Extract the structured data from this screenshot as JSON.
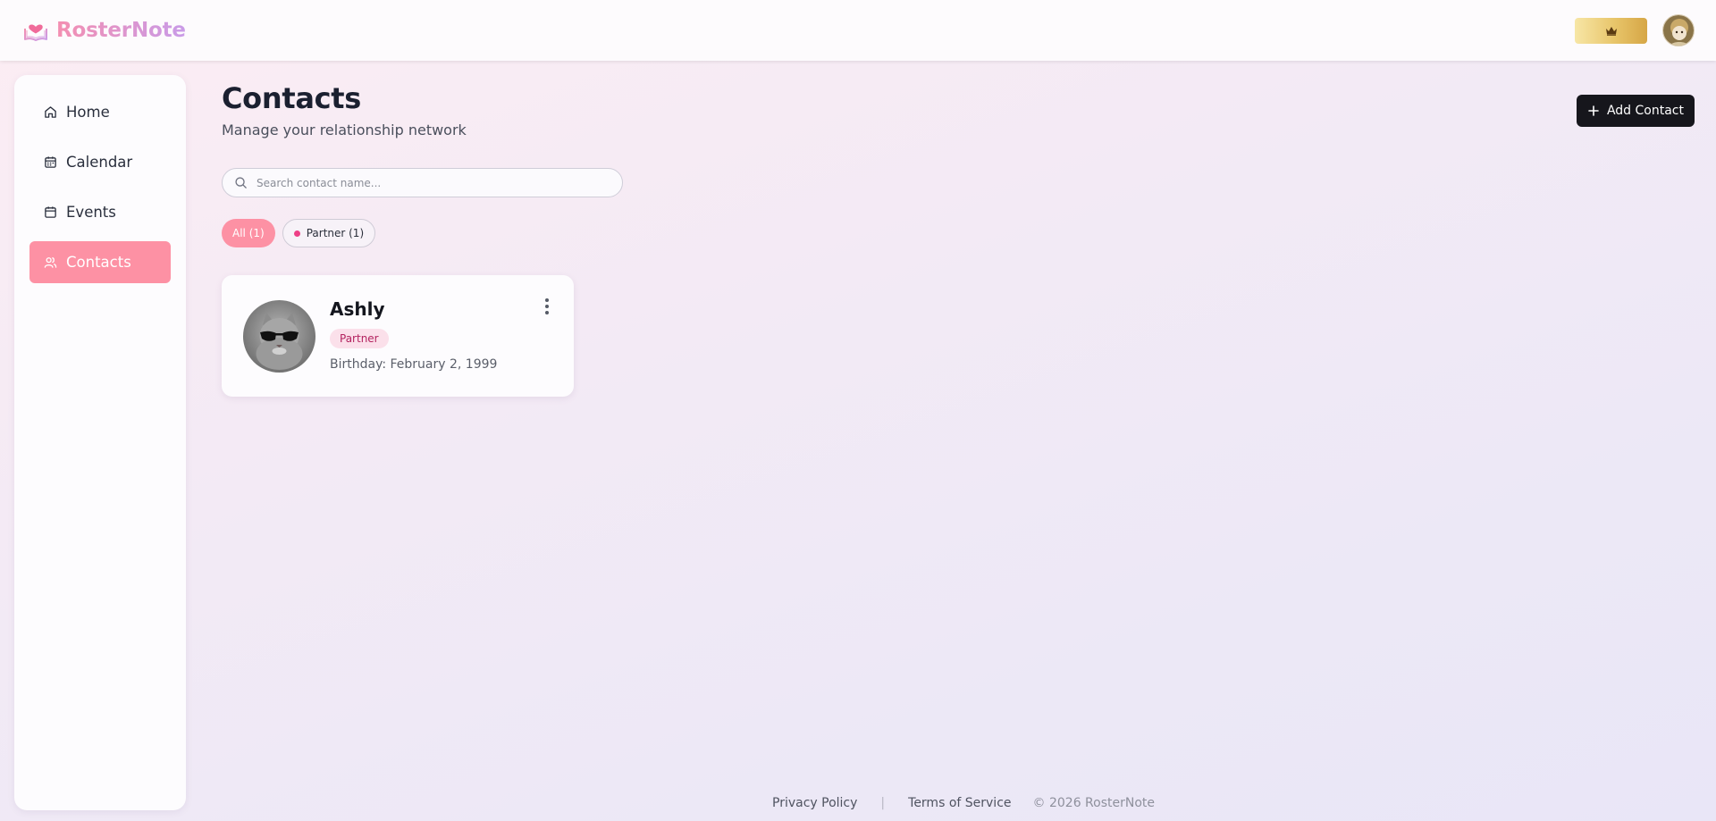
{
  "brand": {
    "name": "RosterNote",
    "icon": "book-heart-icon"
  },
  "header": {
    "premium_icon": "crown-icon",
    "avatar": "user-avatar"
  },
  "sidebar": {
    "items": [
      {
        "label": "Home",
        "icon": "home-icon",
        "active": false
      },
      {
        "label": "Calendar",
        "icon": "calendar-icon",
        "active": false
      },
      {
        "label": "Events",
        "icon": "calendar-icon",
        "active": false
      },
      {
        "label": "Contacts",
        "icon": "users-icon",
        "active": true
      }
    ]
  },
  "main": {
    "title": "Contacts",
    "subtitle": "Manage your relationship network",
    "add_button_label": "Add Contact",
    "search": {
      "placeholder": "Search contact name...",
      "value": ""
    },
    "filters": [
      {
        "label": "All (1)",
        "active": true
      },
      {
        "label": "Partner (1)",
        "active": false,
        "dot_color": "#ee3f86"
      }
    ],
    "contacts": [
      {
        "name": "Ashly",
        "tag": "Partner",
        "birthday": "Birthday: February 2, 1999"
      }
    ]
  },
  "footer": {
    "privacy": "Privacy Policy",
    "separator": "|",
    "terms": "Terms of Service",
    "copyright": "© 2026 RosterNote"
  },
  "colors": {
    "accent_pink": "#fd91a4",
    "tag_bg": "#fbe0ea",
    "tag_text": "#b3235f",
    "button_dark": "#16161c"
  }
}
